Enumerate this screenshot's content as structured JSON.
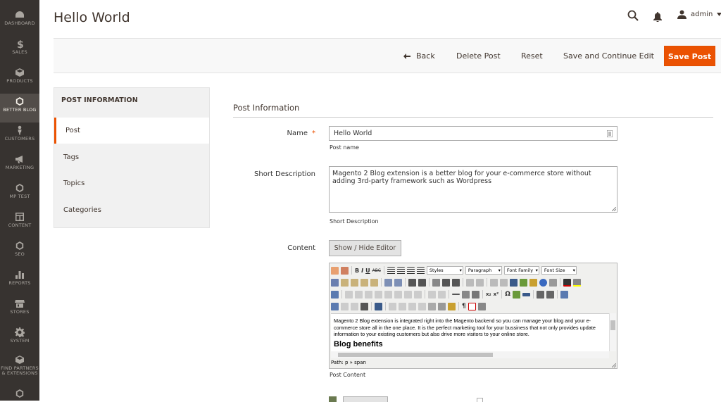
{
  "nav": [
    {
      "label": "DASHBOARD",
      "icon": "dashboard-icon"
    },
    {
      "label": "SALES",
      "icon": "dollar-icon"
    },
    {
      "label": "PRODUCTS",
      "icon": "box-icon"
    },
    {
      "label": "BETTER BLOG",
      "icon": "hexagon-icon",
      "active": true
    },
    {
      "label": "CUSTOMERS",
      "icon": "person-icon"
    },
    {
      "label": "MARKETING",
      "icon": "megaphone-icon"
    },
    {
      "label": "MP TEST",
      "icon": "hexagon-icon"
    },
    {
      "label": "CONTENT",
      "icon": "layout-icon"
    },
    {
      "label": "SEO",
      "icon": "hexagon-icon"
    },
    {
      "label": "REPORTS",
      "icon": "bar-chart-icon"
    },
    {
      "label": "STORES",
      "icon": "store-icon"
    },
    {
      "label": "SYSTEM",
      "icon": "gear-icon"
    },
    {
      "label_line1": "FIND PARTNERS",
      "label_line2": "& EXTENSIONS",
      "icon": "box-icon"
    }
  ],
  "header": {
    "title": "Hello World",
    "user": "admin"
  },
  "actions": {
    "back": "Back",
    "delete": "Delete Post",
    "reset": "Reset",
    "save_continue": "Save and Continue Edit",
    "save": "Save Post"
  },
  "tabs": {
    "heading": "POST INFORMATION",
    "items": [
      "Post",
      "Tags",
      "Topics",
      "Categories"
    ]
  },
  "form": {
    "section_title": "Post Information",
    "name_label": "Name",
    "name_value": "Hello World",
    "name_note": "Post name",
    "short_label": "Short Description",
    "short_value": "Magento 2 Blog extension is a better blog for your e-commerce store without adding 3rd-party framework such as Wordpress",
    "short_note": "Short Description",
    "content_label": "Content",
    "toggle_editor": "Show / Hide Editor",
    "content_note": "Post Content"
  },
  "editor": {
    "styles": "Styles",
    "paragraph": "Paragraph",
    "font_family": "Font Family",
    "font_size": "Font Size",
    "body_text": "Magento 2 Blog extension is integrated right into the Magento backend so you can manage your blog and your e-commerce store all in the one place. It is the perfect marketing tool for your bussiness that not only provides update information to your existing customers but also drive more visitors to your online store.",
    "body_heading": "Blog benefits",
    "path": "Path: p » span"
  },
  "colors": {
    "accent": "#eb5202",
    "nav_bg": "#373330",
    "nav_active": "#524d49"
  }
}
